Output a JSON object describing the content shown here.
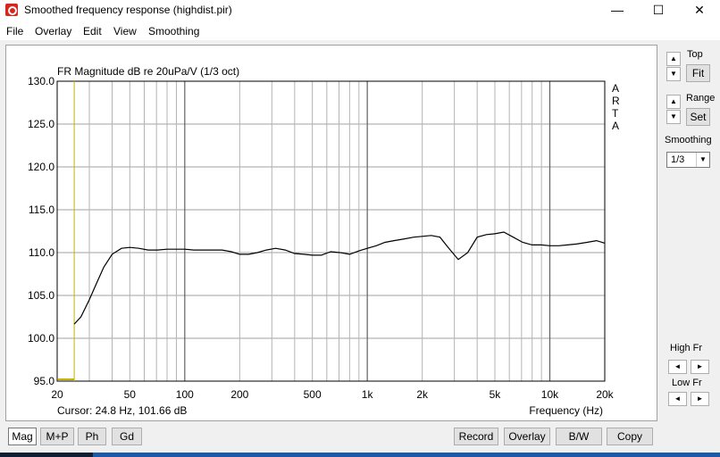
{
  "window": {
    "title": "Smoothed frequency response (highdist.pir)",
    "controls": {
      "minimize": "—",
      "maximize": "☐",
      "close": "✕"
    }
  },
  "menu": [
    "File",
    "Overlay",
    "Edit",
    "View",
    "Smoothing"
  ],
  "plot": {
    "title": "FR Magnitude dB re 20uPa/V (1/3 oct)",
    "y_tick_labels": [
      "130.0",
      "125.0",
      "120.0",
      "115.0",
      "110.0",
      "105.0",
      "100.0",
      "95.0"
    ],
    "x_tick_labels": [
      "20",
      "50",
      "100",
      "200",
      "500",
      "1k",
      "2k",
      "5k",
      "10k",
      "20k"
    ],
    "xlabel": "Frequency (Hz)",
    "watermark": [
      "A",
      "R",
      "T",
      "A"
    ],
    "cursor_readout": "Cursor: 24.8 Hz, 101.66 dB",
    "colors": {
      "curve": "#000000",
      "cursor": "#c8b400",
      "grid": "#a0a0a0"
    }
  },
  "chart_data": {
    "type": "line",
    "x_scale": "log",
    "xlim": [
      20,
      20000
    ],
    "ylim": [
      95,
      130
    ],
    "grid": true,
    "cursor_x": 24.8,
    "series": [
      {
        "x": [
          24.8,
          27,
          30,
          33,
          36,
          40,
          45,
          50,
          56,
          63,
          71,
          80,
          90,
          100,
          112,
          125,
          140,
          160,
          180,
          200,
          224,
          250,
          280,
          315,
          355,
          400,
          450,
          500,
          560,
          630,
          710,
          800,
          900,
          1000,
          1120,
          1250,
          1400,
          1600,
          1800,
          2000,
          2240,
          2500,
          2800,
          3150,
          3550,
          4000,
          4500,
          5000,
          5600,
          6300,
          7100,
          8000,
          9000,
          10000,
          11200,
          12500,
          14000,
          16000,
          18000,
          20000
        ],
        "y": [
          101.66,
          102.5,
          104.5,
          106.5,
          108.3,
          109.8,
          110.5,
          110.6,
          110.5,
          110.3,
          110.3,
          110.4,
          110.4,
          110.4,
          110.3,
          110.3,
          110.3,
          110.3,
          110.1,
          109.8,
          109.8,
          110.0,
          110.3,
          110.5,
          110.3,
          109.9,
          109.8,
          109.7,
          109.7,
          110.1,
          110.0,
          109.8,
          110.2,
          110.5,
          110.8,
          111.2,
          111.4,
          111.6,
          111.8,
          111.9,
          112.0,
          111.8,
          110.5,
          109.2,
          110.0,
          111.8,
          112.1,
          112.2,
          112.4,
          111.8,
          111.2,
          110.9,
          110.9,
          110.8,
          110.8,
          110.9,
          111.0,
          111.2,
          111.4,
          111.1
        ]
      }
    ]
  },
  "right_panel": {
    "top_label": "Top",
    "fit_label": "Fit",
    "range_label": "Range",
    "set_label": "Set",
    "smoothing_label": "Smoothing",
    "smoothing_value": "1/3",
    "high_fr_label": "High Fr",
    "low_fr_label": "Low Fr",
    "up_arrow": "▲",
    "down_arrow": "▼",
    "left_arrow": "◄",
    "right_arrow": "►"
  },
  "bottom_tabs": [
    "Mag",
    "M+P",
    "Ph",
    "Gd"
  ],
  "bottom_buttons": [
    "Record",
    "Overlay",
    "B/W",
    "Copy"
  ]
}
